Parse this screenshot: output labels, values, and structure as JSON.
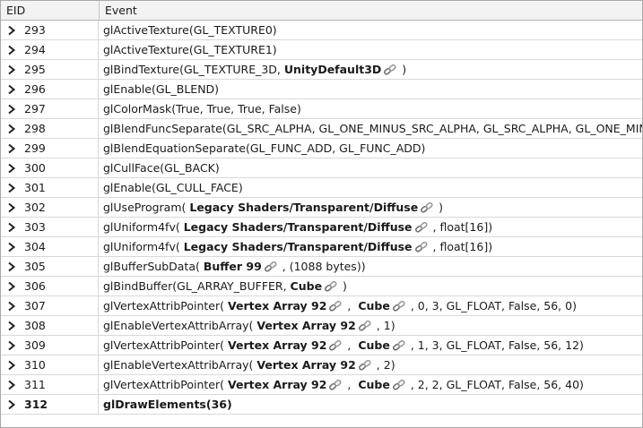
{
  "columns": {
    "eid": "EID",
    "event": "Event"
  },
  "rows": [
    {
      "eid": "293",
      "parts": [
        {
          "t": "glActiveTexture(GL_TEXTURE0)"
        }
      ]
    },
    {
      "eid": "294",
      "parts": [
        {
          "t": "glActiveTexture(GL_TEXTURE1)"
        }
      ]
    },
    {
      "eid": "295",
      "parts": [
        {
          "t": "glBindTexture(GL_TEXTURE_3D, "
        },
        {
          "t": "UnityDefault3D",
          "b": true,
          "link": true
        },
        {
          "t": " )"
        }
      ]
    },
    {
      "eid": "296",
      "parts": [
        {
          "t": "glEnable(GL_BLEND)"
        }
      ]
    },
    {
      "eid": "297",
      "parts": [
        {
          "t": "glColorMask(True, True, True, False)"
        }
      ]
    },
    {
      "eid": "298",
      "parts": [
        {
          "t": "glBlendFuncSeparate(GL_SRC_ALPHA, GL_ONE_MINUS_SRC_ALPHA, GL_SRC_ALPHA, GL_ONE_MIN..."
        }
      ]
    },
    {
      "eid": "299",
      "parts": [
        {
          "t": "glBlendEquationSeparate(GL_FUNC_ADD, GL_FUNC_ADD)"
        }
      ]
    },
    {
      "eid": "300",
      "parts": [
        {
          "t": "glCullFace(GL_BACK)"
        }
      ]
    },
    {
      "eid": "301",
      "parts": [
        {
          "t": "glEnable(GL_CULL_FACE)"
        }
      ]
    },
    {
      "eid": "302",
      "parts": [
        {
          "t": "glUseProgram( "
        },
        {
          "t": "Legacy Shaders/Transparent/Diffuse",
          "b": true,
          "link": true
        },
        {
          "t": " )"
        }
      ]
    },
    {
      "eid": "303",
      "parts": [
        {
          "t": "glUniform4fv( "
        },
        {
          "t": "Legacy Shaders/Transparent/Diffuse",
          "b": true,
          "link": true
        },
        {
          "t": " , float[16])"
        }
      ]
    },
    {
      "eid": "304",
      "parts": [
        {
          "t": "glUniform4fv( "
        },
        {
          "t": "Legacy Shaders/Transparent/Diffuse",
          "b": true,
          "link": true
        },
        {
          "t": " , float[16])"
        }
      ]
    },
    {
      "eid": "305",
      "parts": [
        {
          "t": "glBufferSubData( "
        },
        {
          "t": "Buffer 99",
          "b": true,
          "link": true
        },
        {
          "t": " , (1088 bytes))"
        }
      ]
    },
    {
      "eid": "306",
      "parts": [
        {
          "t": "glBindBuffer(GL_ARRAY_BUFFER, "
        },
        {
          "t": "Cube",
          "b": true,
          "link": true
        },
        {
          "t": " )"
        }
      ]
    },
    {
      "eid": "307",
      "parts": [
        {
          "t": "glVertexAttribPointer( "
        },
        {
          "t": "Vertex Array 92",
          "b": true,
          "link": true
        },
        {
          "t": " ,  "
        },
        {
          "t": "Cube",
          "b": true,
          "link": true
        },
        {
          "t": " , 0, 3, GL_FLOAT, False, 56, 0)"
        }
      ]
    },
    {
      "eid": "308",
      "parts": [
        {
          "t": "glEnableVertexAttribArray( "
        },
        {
          "t": "Vertex Array 92",
          "b": true,
          "link": true
        },
        {
          "t": " , 1)"
        }
      ]
    },
    {
      "eid": "309",
      "parts": [
        {
          "t": "glVertexAttribPointer( "
        },
        {
          "t": "Vertex Array 92",
          "b": true,
          "link": true
        },
        {
          "t": " ,  "
        },
        {
          "t": "Cube",
          "b": true,
          "link": true
        },
        {
          "t": " , 1, 3, GL_FLOAT, False, 56, 12)"
        }
      ]
    },
    {
      "eid": "310",
      "parts": [
        {
          "t": "glEnableVertexAttribArray( "
        },
        {
          "t": "Vertex Array 92",
          "b": true,
          "link": true
        },
        {
          "t": " , 2)"
        }
      ]
    },
    {
      "eid": "311",
      "parts": [
        {
          "t": "glVertexAttribPointer( "
        },
        {
          "t": "Vertex Array 92",
          "b": true,
          "link": true
        },
        {
          "t": " ,  "
        },
        {
          "t": "Cube",
          "b": true,
          "link": true
        },
        {
          "t": " , 2, 2, GL_FLOAT, False, 56, 40)"
        }
      ]
    },
    {
      "eid": "312",
      "draw": true,
      "parts": [
        {
          "t": "glDrawElements(36)",
          "b": true
        }
      ]
    }
  ],
  "icons": {
    "expand": "chevron-right-icon",
    "resource": "chain-link-icon"
  }
}
